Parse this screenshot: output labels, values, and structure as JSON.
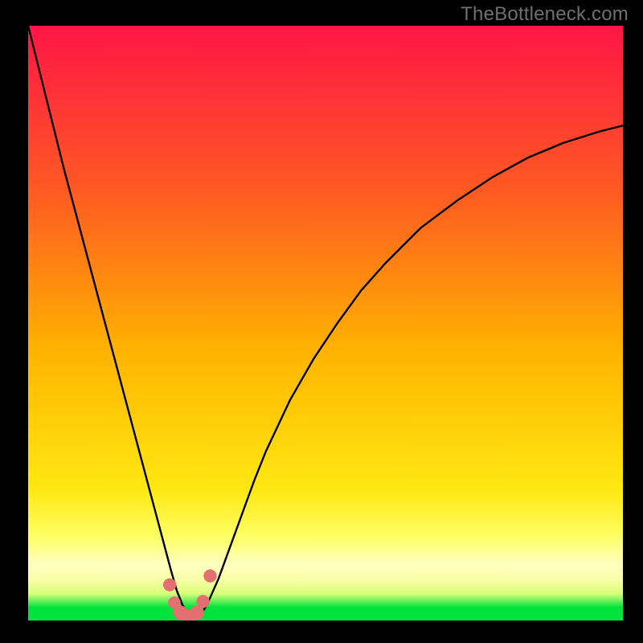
{
  "watermark": "TheBottleneck.com",
  "colors": {
    "frame": "#000000",
    "curve": "#000000",
    "marker_fill": "#e27070",
    "green_band": "#00e33c",
    "gradient_top": "#ff1546",
    "gradient_mid1": "#ff6a1b",
    "gradient_mid2": "#ffd000",
    "gradient_mid3": "#ffff66",
    "gradient_pale": "#ffffc0",
    "gradient_bottom_yellow": "#f5ff6e"
  },
  "chart_data": {
    "type": "line",
    "title": "",
    "xlabel": "",
    "ylabel": "",
    "xlim": [
      0,
      100
    ],
    "ylim": [
      0,
      100
    ],
    "series": [
      {
        "name": "bottleneck-curve",
        "x": [
          0,
          2,
          4,
          6,
          8,
          10,
          12,
          14,
          16,
          18,
          20,
          22,
          24,
          25,
          26,
          27,
          28,
          29,
          30,
          32,
          34,
          36,
          38,
          40,
          44,
          48,
          52,
          56,
          60,
          66,
          72,
          78,
          84,
          90,
          96,
          100
        ],
        "y": [
          100,
          92,
          84,
          76,
          68.5,
          61,
          53.5,
          46,
          38.5,
          31,
          23.5,
          16,
          8.5,
          5,
          2.5,
          1,
          0.5,
          1,
          2.5,
          7,
          12.5,
          18,
          23.5,
          28.5,
          37,
          44,
          50,
          55.5,
          60,
          66,
          70.5,
          74.5,
          77.8,
          80.3,
          82.2,
          83.2
        ]
      }
    ],
    "markers": [
      {
        "x": 23.8,
        "y": 6.0,
        "r": 1.1
      },
      {
        "x": 24.6,
        "y": 3.0,
        "r": 1.05
      },
      {
        "x": 25.6,
        "y": 1.3,
        "r": 1.2
      },
      {
        "x": 27.0,
        "y": 0.6,
        "r": 1.2
      },
      {
        "x": 28.4,
        "y": 1.3,
        "r": 1.2
      },
      {
        "x": 29.4,
        "y": 3.2,
        "r": 1.1
      },
      {
        "x": 30.6,
        "y": 7.5,
        "r": 1.1
      }
    ],
    "green_band": {
      "y0": 0,
      "y1": 2.2
    }
  }
}
